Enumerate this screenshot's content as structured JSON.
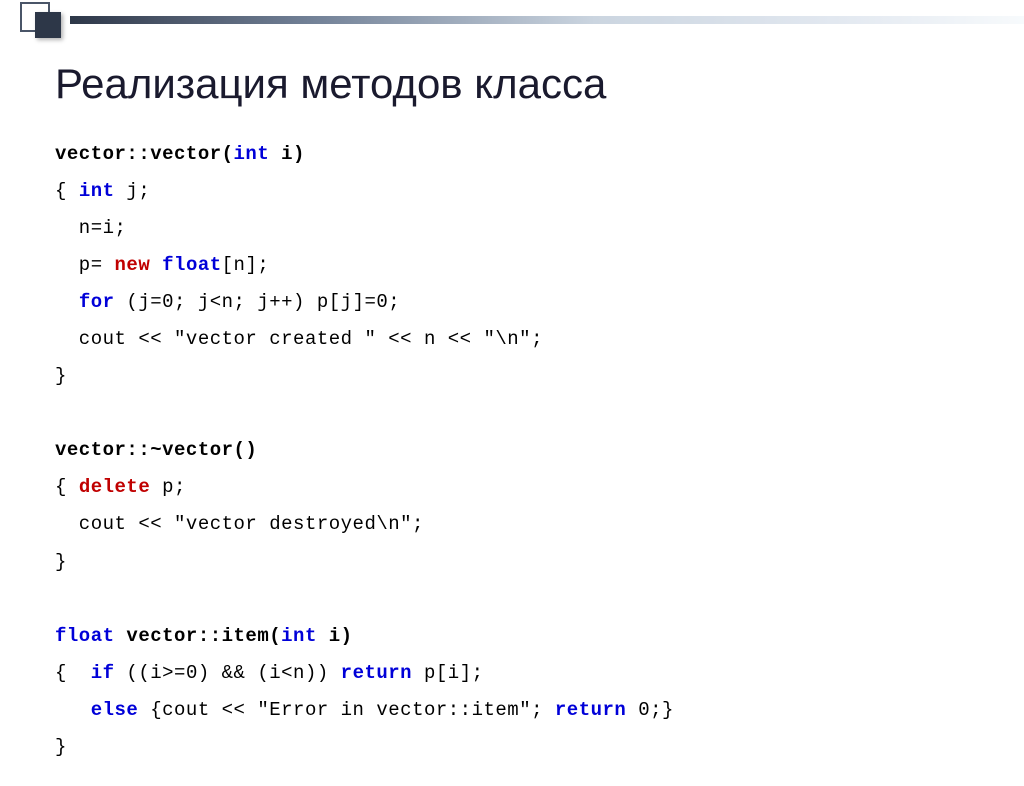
{
  "title": "Реализация методов класса",
  "code": {
    "l1a": "vector::vector(",
    "l1b": "int",
    "l1c": " i)",
    "l2a": "{ ",
    "l2b": "int",
    "l2c": " j;",
    "l3": "  n=i;",
    "l4a": "  p= ",
    "l4b": "new",
    "l4c": " ",
    "l4d": "float",
    "l4e": "[n];",
    "l5a": "  ",
    "l5b": "for",
    "l5c": " (j=0; j<n; j++) p[j]=0;",
    "l6": "  cout << \"vector created \" << n << \"\\n\";",
    "l7": "}",
    "l8": "vector::~vector()",
    "l9a": "{ ",
    "l9b": "delete",
    "l9c": " p;",
    "l10": "  cout << \"vector destroyed\\n\";",
    "l11": "}",
    "l12a": "float",
    "l12b": " vector::item(",
    "l12c": "int",
    "l12d": " i)",
    "l13a": "{  ",
    "l13b": "if",
    "l13c": " ((i>=0) && (i<n)) ",
    "l13d": "return",
    "l13e": " p[i];",
    "l14a": "   ",
    "l14b": "else",
    "l14c": " {cout << \"Error in vector::item\"; ",
    "l14d": "return",
    "l14e": " 0;}",
    "l15": "}"
  }
}
